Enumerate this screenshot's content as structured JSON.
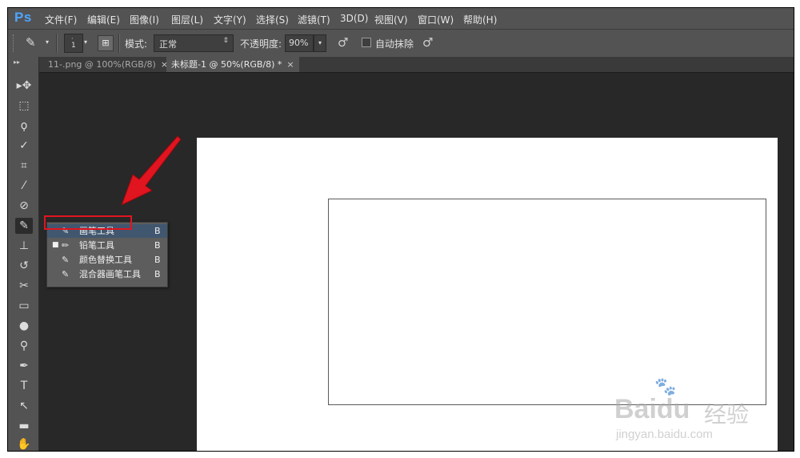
{
  "app": {
    "logo": "Ps"
  },
  "menu": [
    "文件(F)",
    "编辑(E)",
    "图像(I)",
    "图层(L)",
    "文字(Y)",
    "选择(S)",
    "滤镜(T)",
    "3D(D)",
    "视图(V)",
    "窗口(W)",
    "帮助(H)"
  ],
  "options": {
    "brush_size": "1",
    "mode_label": "模式:",
    "mode_value": "正常",
    "opacity_label": "不透明度:",
    "opacity_value": "90%",
    "auto_erase_label": "自动抹除",
    "auto_erase_checked": false
  },
  "tabs": [
    {
      "label": "11-.png @ 100%(RGB/8)",
      "close": "×",
      "active": false
    },
    {
      "label": "未标题-1 @ 50%(RGB/8) *",
      "close": "×",
      "active": true
    }
  ],
  "tools": [
    {
      "name": "move-tool",
      "glyph": "▸✥"
    },
    {
      "name": "marquee-tool",
      "glyph": "⬚"
    },
    {
      "name": "lasso-tool",
      "glyph": "ϙ"
    },
    {
      "name": "quick-selection-tool",
      "glyph": "✓"
    },
    {
      "name": "crop-tool",
      "glyph": "⌗"
    },
    {
      "name": "eyedropper-tool",
      "glyph": "⁄"
    },
    {
      "name": "healing-brush-tool",
      "glyph": "⊘"
    },
    {
      "name": "brush-tool",
      "glyph": "✎"
    },
    {
      "name": "clone-stamp-tool",
      "glyph": "⊥"
    },
    {
      "name": "history-brush-tool",
      "glyph": "↺"
    },
    {
      "name": "eraser-tool",
      "glyph": "✂"
    },
    {
      "name": "gradient-tool",
      "glyph": "▭"
    },
    {
      "name": "blur-tool",
      "glyph": "●"
    },
    {
      "name": "dodge-tool",
      "glyph": "⚲"
    },
    {
      "name": "pen-tool",
      "glyph": "✒"
    },
    {
      "name": "type-tool",
      "glyph": "T"
    },
    {
      "name": "path-selection-tool",
      "glyph": "↖"
    },
    {
      "name": "rectangle-tool",
      "glyph": "▬"
    },
    {
      "name": "hand-tool",
      "glyph": "✋"
    }
  ],
  "flyout": [
    {
      "label": "画笔工具",
      "key": "B",
      "icon": "✎"
    },
    {
      "label": "铅笔工具",
      "key": "B",
      "icon": "✏"
    },
    {
      "label": "颜色替换工具",
      "key": "B",
      "icon": "✎"
    },
    {
      "label": "混合器画笔工具",
      "key": "B",
      "icon": "✎"
    }
  ],
  "watermark": {
    "brand": "Baidu",
    "cn": "经验",
    "url": "jingyan.baidu.com"
  },
  "colors": {
    "menu_bg": "#535353",
    "canvas_bg": "#282828",
    "highlight": "#e0151f",
    "accent": "#4ea5ff"
  }
}
